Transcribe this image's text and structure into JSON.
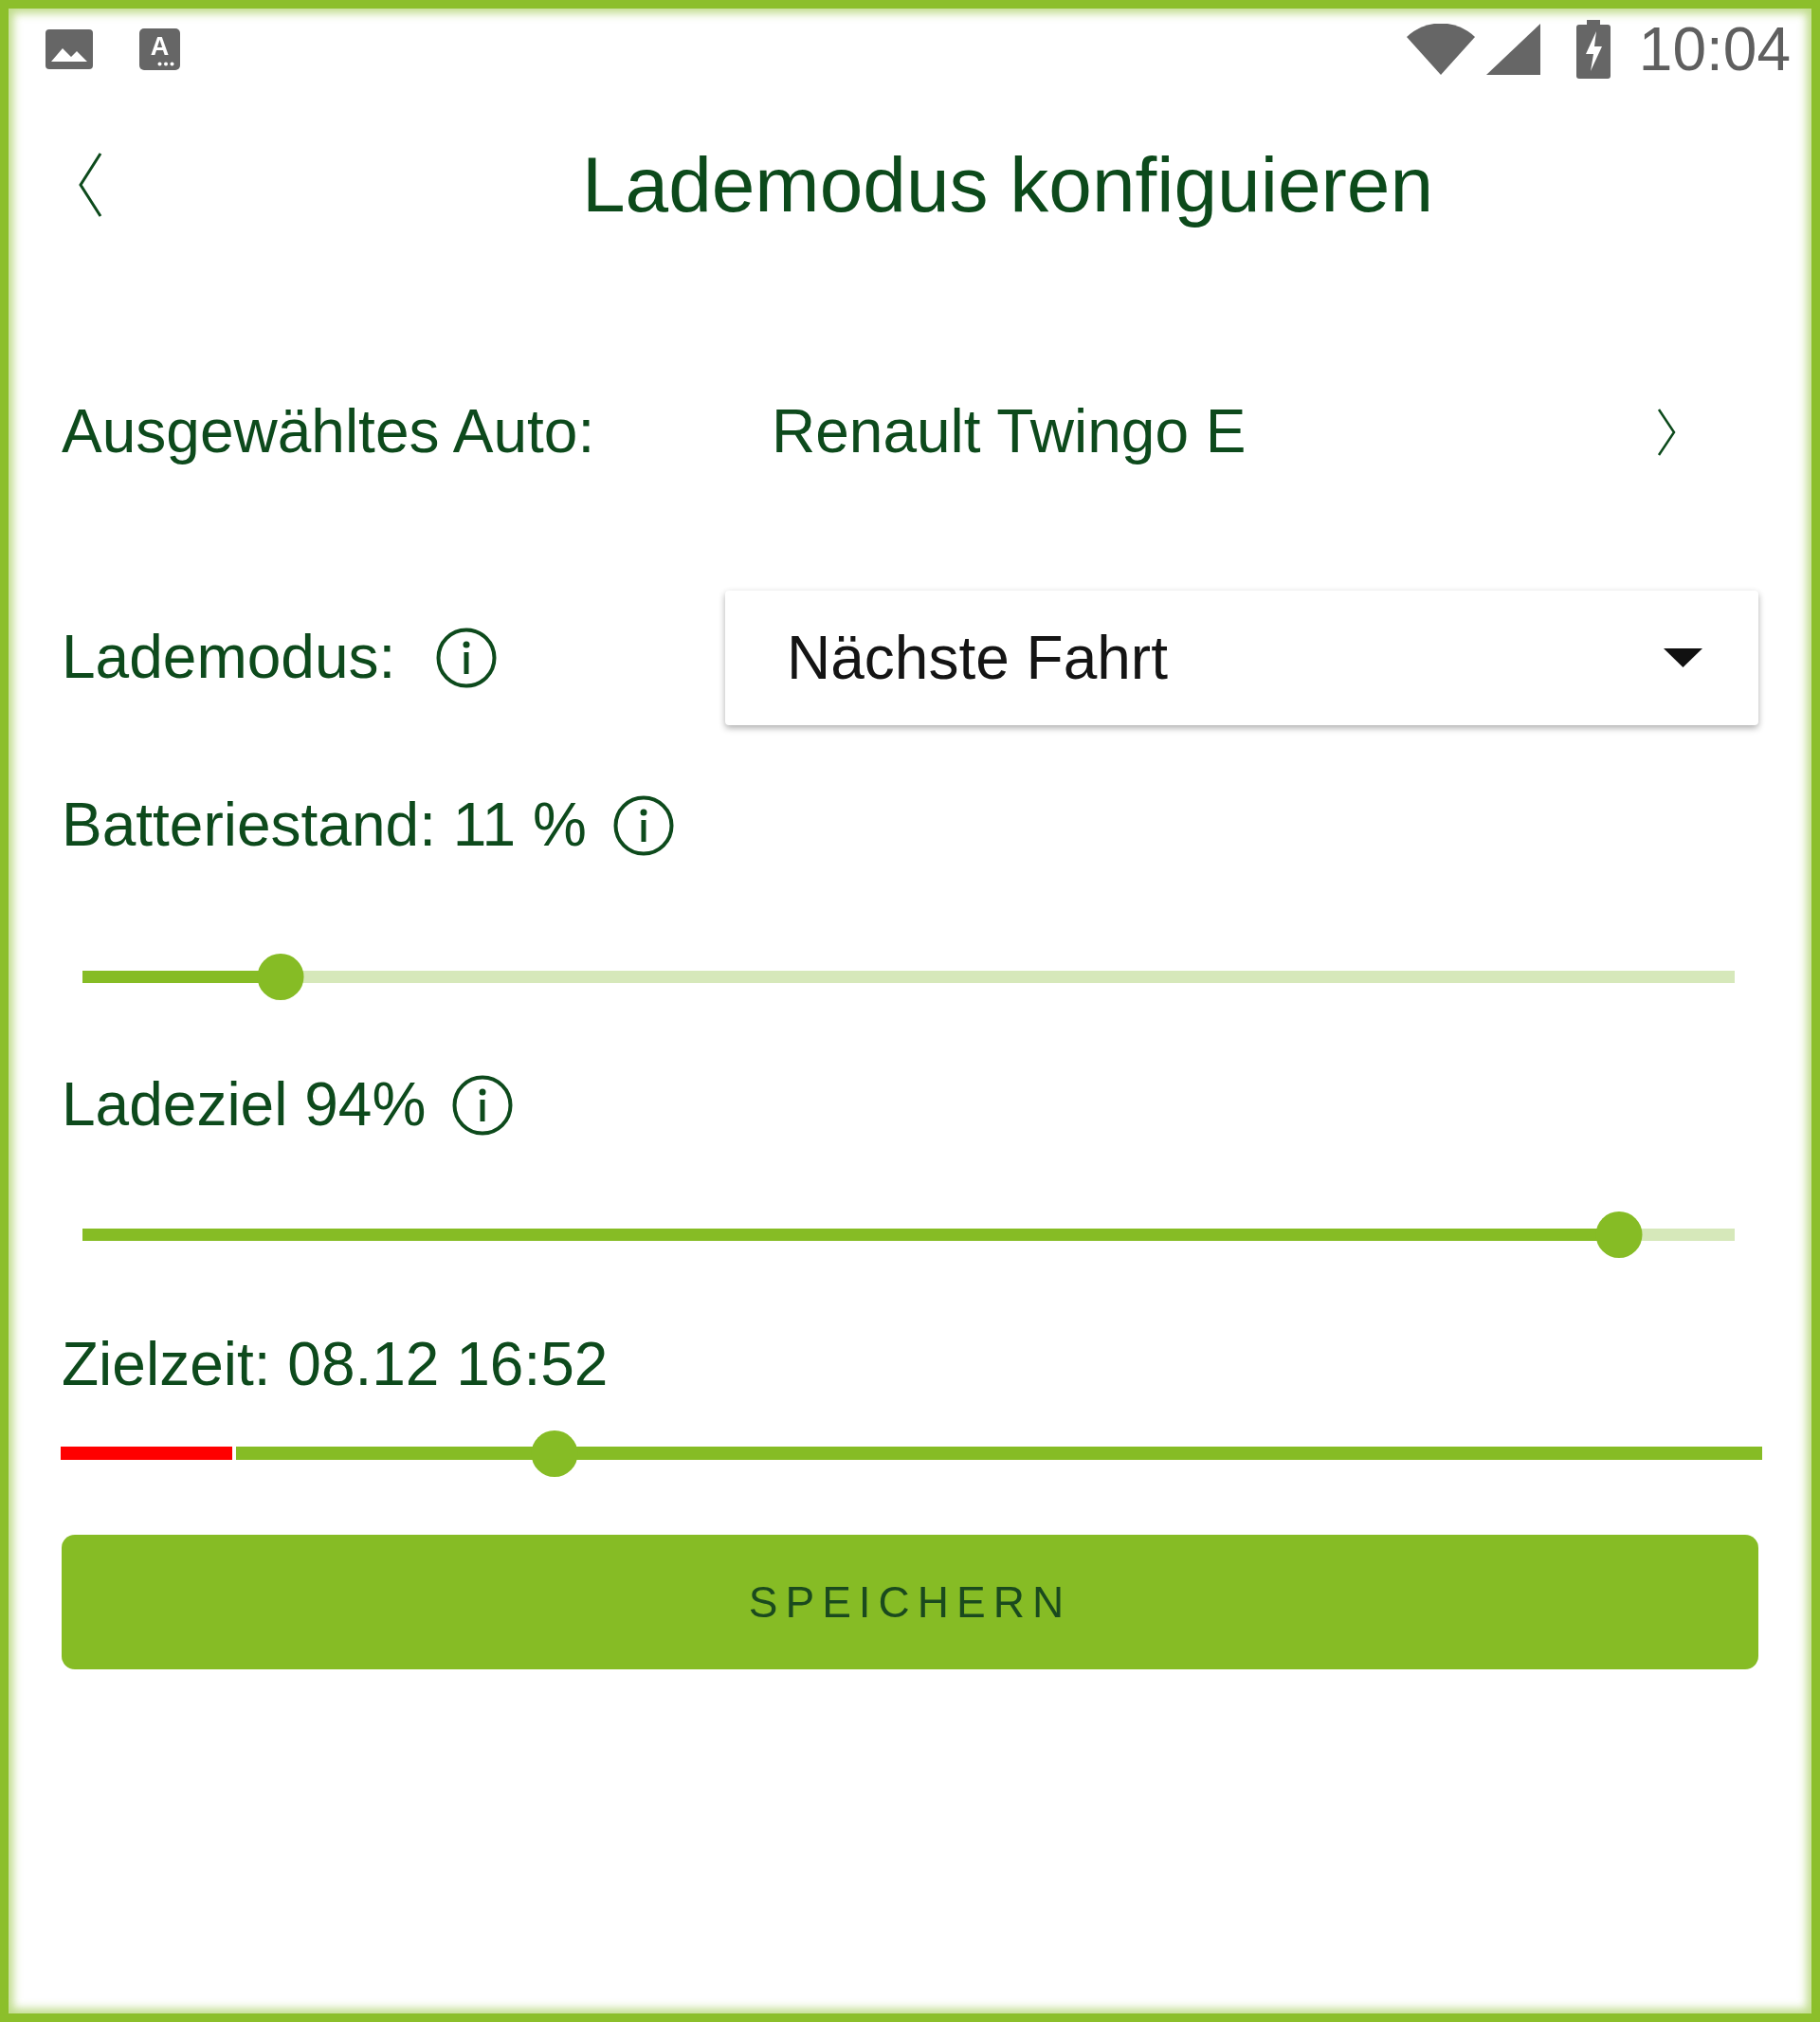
{
  "status_bar": {
    "app_icon_letter": "A",
    "time": "10:04"
  },
  "header": {
    "title": "Lademodus konfiguieren"
  },
  "car": {
    "label": "Ausgewähltes Auto:",
    "value": "Renault Twingo E"
  },
  "mode": {
    "label": "Lademodus:",
    "info": true,
    "value": "Nächste Fahrt"
  },
  "sliders": [
    {
      "kind": "level",
      "label": "Batteriestand: 11 %",
      "info": true,
      "level": 0.12
    },
    {
      "kind": "level",
      "label": "Ladeziel 94%",
      "info": true,
      "level": 0.93
    },
    {
      "kind": "time",
      "label": "Zielzeit: 08.12 16:52",
      "info": false,
      "level": 0.29
    }
  ],
  "save_button": {
    "label": "SPEICHERN"
  }
}
